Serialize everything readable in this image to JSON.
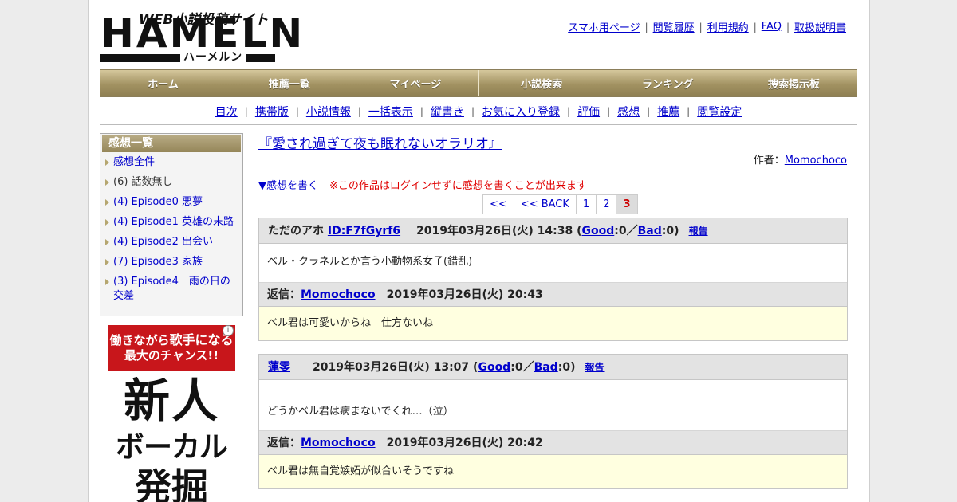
{
  "logo": {
    "subtitle": "WEB小説投稿サイト",
    "main": "HAMELN",
    "kana": "ハーメルン"
  },
  "top_links": [
    "スマホ用ページ",
    "閲覧履歴",
    "利用規約",
    "FAQ",
    "取扱説明書"
  ],
  "main_nav": [
    "ホーム",
    "推薦一覧",
    "マイページ",
    "小説検索",
    "ランキング",
    "捜索掲示板"
  ],
  "sub_nav": [
    "目次",
    "携帯版",
    "小説情報",
    "一括表示",
    "縦書き",
    "お気に入り登録",
    "評価",
    "感想",
    "推薦",
    "閲覧設定"
  ],
  "sidebar": {
    "title": "感想一覧",
    "items": [
      {
        "label": "感想全件",
        "link": true
      },
      {
        "label": "(6) 話数無し",
        "link": false
      },
      {
        "label": "(4) Episode0 悪夢",
        "link": true
      },
      {
        "label": "(4) Episode1 英雄の末路",
        "link": true
      },
      {
        "label": "(4) Episode2 出会い",
        "link": true
      },
      {
        "label": "(7) Episode3 家族",
        "link": true
      },
      {
        "label": "(3) Episode4　雨の日の交差",
        "link": true
      }
    ]
  },
  "ad": {
    "head_line1": "働きながら",
    "head_line1_big": "歌手になる",
    "head_line2": "最大のチャンス!!",
    "line1": "新人",
    "line2": "ボーカル",
    "line3": "発掘",
    "info_icon": "i"
  },
  "novel": {
    "title": "『愛され過ぎて夜も眠れないオラリオ』",
    "author_label": "作者：",
    "author": "Momochoco"
  },
  "write": {
    "link": "▼感想を書く",
    "warning": "※この作品はログインせずに感想を書くことが出来ます"
  },
  "pager": {
    "first": "<<",
    "back": "<< BACK",
    "pages": [
      "1",
      "2",
      "3"
    ],
    "current": "3"
  },
  "comments": [
    {
      "user": "ただのアホ",
      "user_id": "ID:F7fGyrf6",
      "date": "2019年03月26日(火) 14:38",
      "good_label": "Good",
      "good": "0",
      "bad_label": "Bad",
      "bad": "0",
      "report": "報告",
      "body": "ベル・クラネルとか言う小動物系女子(錯乱)",
      "reply_label": "返信：",
      "reply_author": "Momochoco",
      "reply_date": "2019年03月26日(火) 20:43",
      "reply_body": "ベル君は可愛いからね　仕方ないね"
    },
    {
      "user": "蓮零",
      "user_id": "",
      "date": "2019年03月26日(火) 13:07",
      "good_label": "Good",
      "good": "0",
      "bad_label": "Bad",
      "bad": "0",
      "report": "報告",
      "body": "どうかベル君は病まないでくれ…（泣）",
      "reply_label": "返信：",
      "reply_author": "Momochoco",
      "reply_date": "2019年03月26日(火) 20:42",
      "reply_body": "ベル君は無自覚嫉妬が似合いそうですね"
    }
  ]
}
